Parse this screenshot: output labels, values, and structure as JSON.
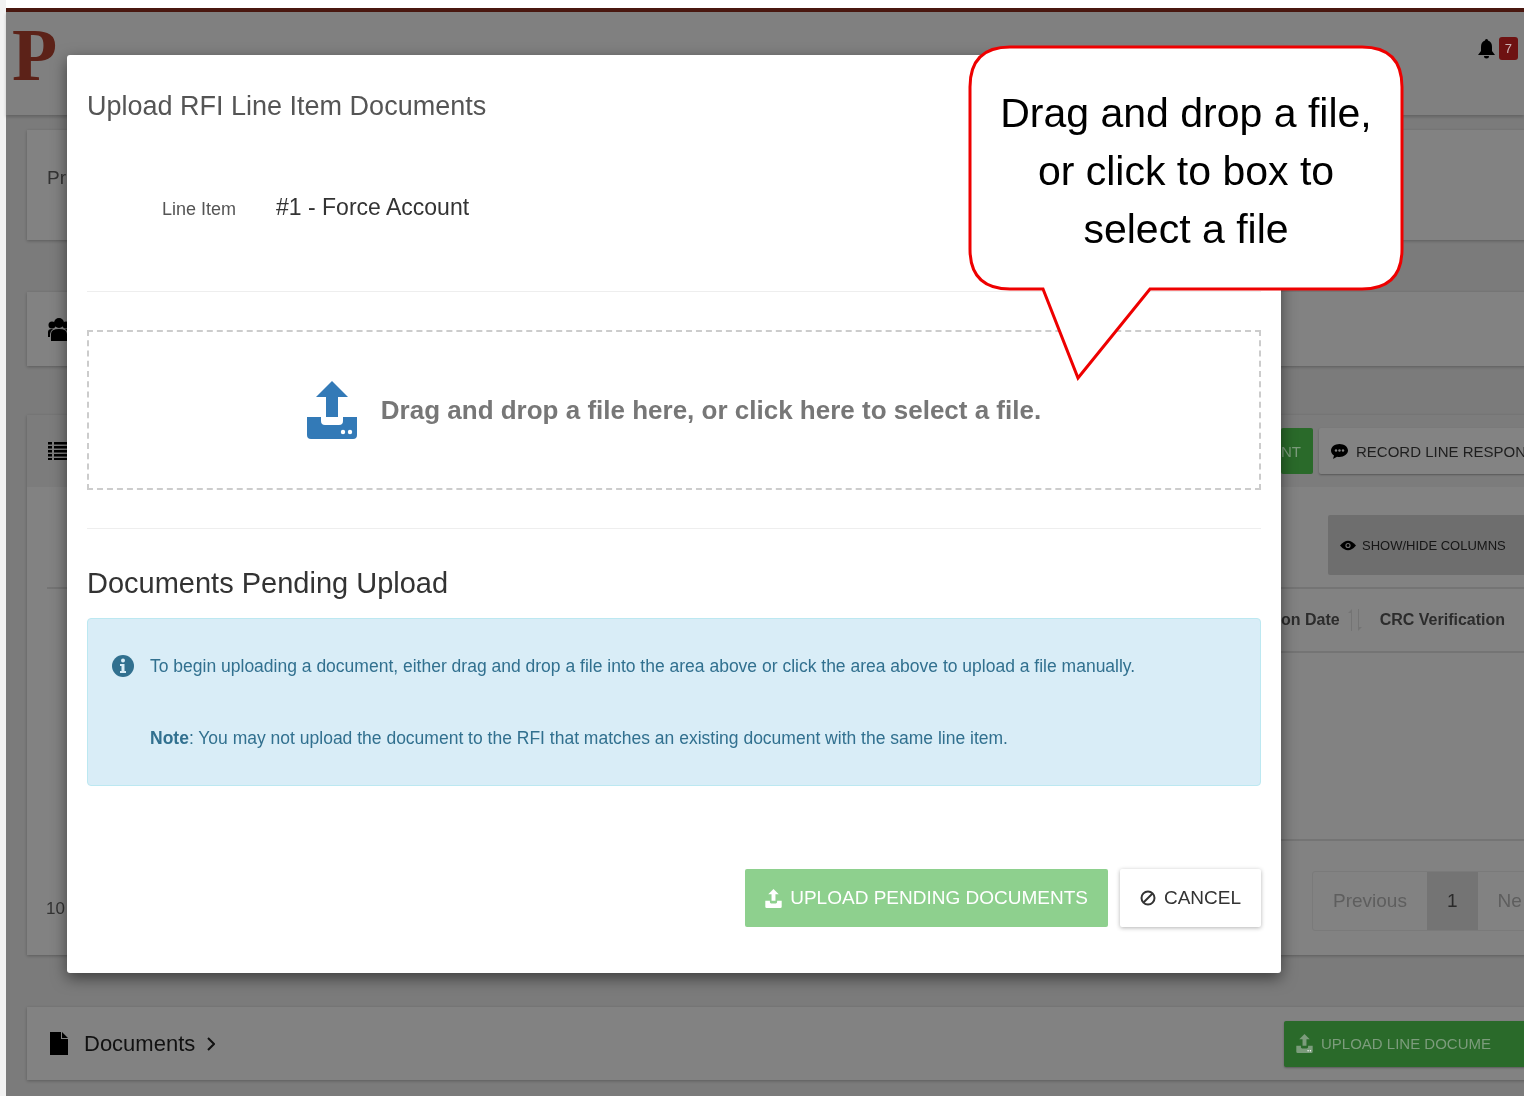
{
  "header": {
    "logo": "P",
    "notification_count": "7"
  },
  "background": {
    "summary_text": "Pr",
    "toolbar_buttons": [
      {
        "label": "NT",
        "kind": "success"
      },
      {
        "label": "RECORD LINE RESPON",
        "kind": "default"
      }
    ],
    "columns_button": "SHOW/HIDE COLUMNS",
    "columns": [
      {
        "label": "on Date",
        "sortable": true
      },
      {
        "label": "CRC Verification",
        "sortable": false
      }
    ],
    "page_size": "10",
    "pagination": [
      {
        "label": "Previous",
        "selected": false
      },
      {
        "label": "1",
        "selected": true
      },
      {
        "label": "Ne",
        "selected": false
      }
    ],
    "documents_section": {
      "title": "Documents",
      "button": "UPLOAD LINE DOCUME"
    }
  },
  "modal": {
    "title": "Upload RFI Line Item Documents",
    "line_item": {
      "label": "Line Item",
      "value": "#1 - Force Account"
    },
    "dropzone": {
      "text": "Drag and drop a file here, or click here to select a file."
    },
    "pending_title": "Documents Pending Upload",
    "info": [
      "To begin uploading a document, either drag and drop a file into the area above or click the area above to upload a file manually.",
      "**Note**: You may not upload the document to the RFI that matches an existing document with the same line item."
    ],
    "buttons": [
      {
        "label": "UPLOAD PENDING DOCUMENTS",
        "kind": "primary",
        "disabled": true
      },
      {
        "label": "CANCEL",
        "kind": "cancel",
        "disabled": false
      }
    ]
  },
  "callout": {
    "text": "Drag and drop a file, or click to box to select a file"
  }
}
